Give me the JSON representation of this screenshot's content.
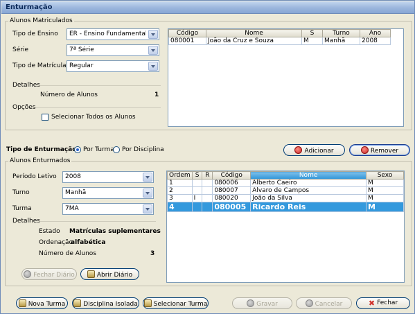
{
  "window": {
    "title": "Enturmação"
  },
  "alunos_matriculados": {
    "legend": "Alunos Matriculados",
    "tipo_ensino": {
      "label": "Tipo de Ensino",
      "value": "ER - Ensino Fundamental de ..."
    },
    "serie": {
      "label": "Série",
      "value": "7ª Série"
    },
    "tipo_matricula": {
      "label": "Tipo de Matrícula",
      "value": "Regular"
    },
    "detalhes_label": "Detalhes",
    "numero_alunos_label": "Número de Alunos",
    "numero_alunos_value": "1",
    "opcoes_label": "Opções",
    "selecionar_todos_label": "Selecionar Todos os Alunos",
    "table": {
      "headers": [
        "Código",
        "Nome",
        "S",
        "Turno",
        "Ano"
      ],
      "rows": [
        [
          "080001",
          "João da Cruz e Souza",
          "M",
          "Manhã",
          "2008"
        ]
      ]
    }
  },
  "tipo_enturmacao": {
    "label": "Tipo de Enturmação",
    "opcao_turma": "Por Turma",
    "opcao_disciplina": "Por Disciplina",
    "selected": "turma"
  },
  "actions": {
    "adicionar": "Adicionar",
    "remover": "Remover"
  },
  "alunos_enturmados": {
    "legend": "Alunos Enturmados",
    "periodo_letivo": {
      "label": "Período Letivo",
      "value": "2008"
    },
    "turno": {
      "label": "Turno",
      "value": "Manhã"
    },
    "turma": {
      "label": "Turma",
      "value": "7MA"
    },
    "detalhes_label": "Detalhes",
    "estado_label": "Estado",
    "estado_value": "Matrículas suplementares",
    "ordenacao_label": "Ordenação",
    "ordenacao_value": "alfabética",
    "numero_alunos_label": "Número de Alunos",
    "numero_alunos_value": "3",
    "fechar_diario": "Fechar Diário",
    "abrir_diario": "Abrir Diário",
    "table": {
      "headers": [
        "Ordem",
        "S",
        "R",
        "Código",
        "Nome",
        "Sexo"
      ],
      "sorted_column": "Nome",
      "rows": [
        [
          "1",
          "",
          "",
          "080006",
          "Alberto Caeiro",
          "M"
        ],
        [
          "2",
          "",
          "",
          "080007",
          "Alvaro de Campos",
          "M"
        ],
        [
          "3",
          "I",
          "",
          "080020",
          "João da Silva",
          "M"
        ],
        [
          "4",
          "",
          "",
          "080005",
          "Ricardo Reis",
          "M"
        ]
      ],
      "selected_row": 3
    }
  },
  "footer": {
    "nova_turma": "Nova Turma",
    "disciplina_isolada": "Disciplina Isolada",
    "selecionar_turma": "Selecionar Turma",
    "gravar": "Gravar",
    "cancelar": "Cancelar",
    "fechar": "Fechar"
  }
}
